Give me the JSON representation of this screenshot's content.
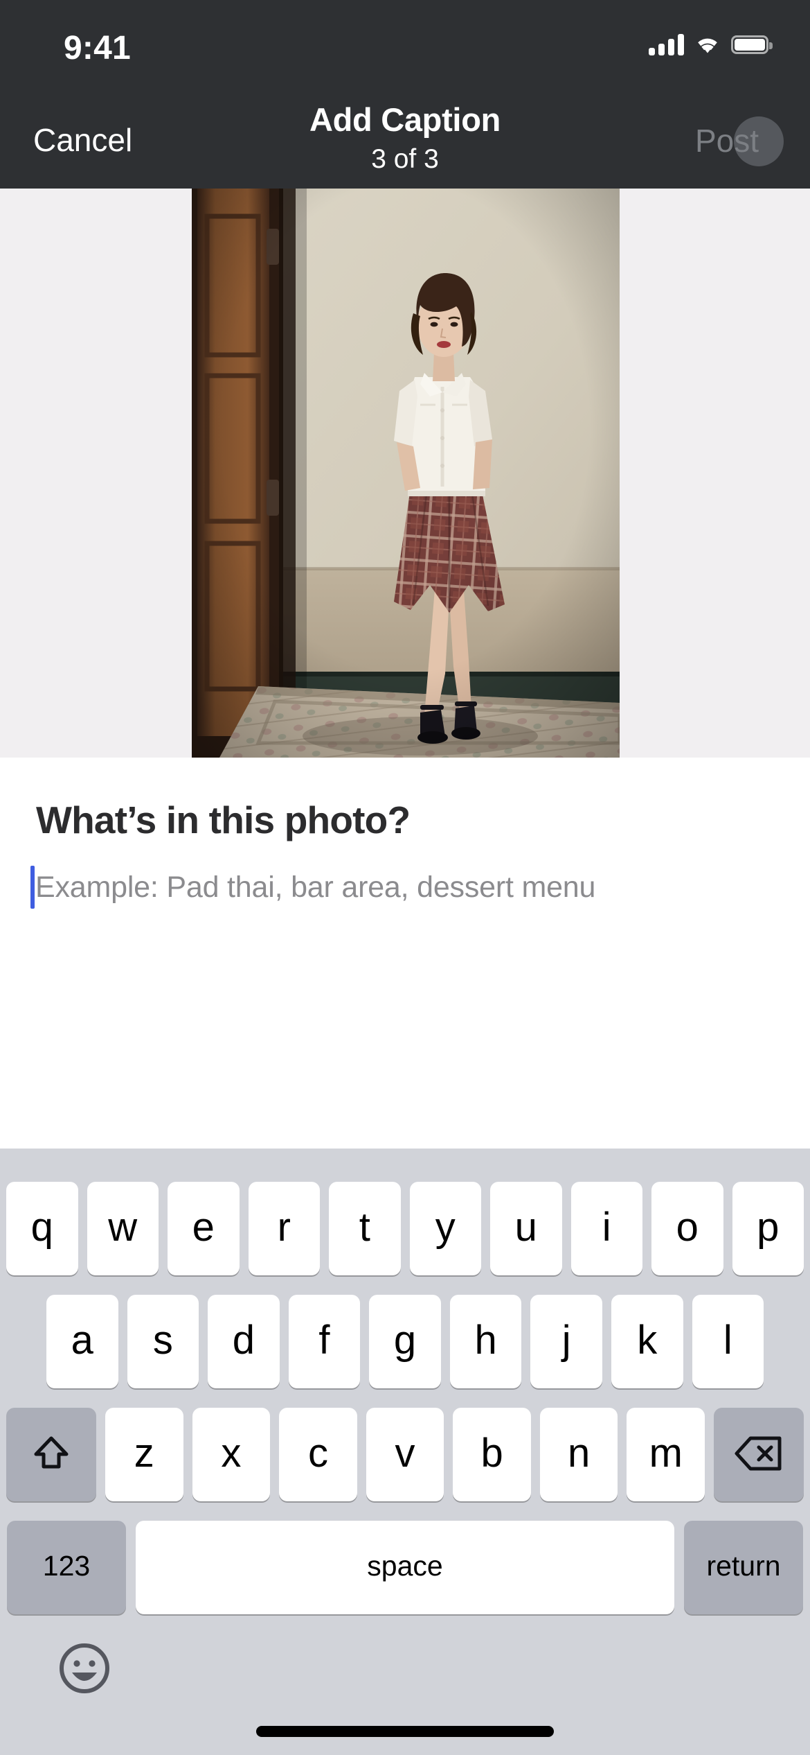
{
  "status_bar": {
    "time": "9:41",
    "cellular_icon": "cellular-signal-icon",
    "wifi_icon": "wifi-icon",
    "battery_icon": "battery-icon"
  },
  "nav_bar": {
    "cancel_label": "Cancel",
    "title": "Add Caption",
    "subtitle": "3 of 3",
    "post_label": "Post",
    "post_enabled": false,
    "background_color": "#2e3033"
  },
  "photo": {
    "alt": "Woman in white blouse and plaid skirt standing in a doorway on a patterned rug",
    "backdrop_color": "#f1eff1"
  },
  "composer": {
    "heading": "What’s in this photo?",
    "caption_value": "",
    "caption_placeholder": "Example: Pad thai, bar area, dessert menu",
    "caret_color": "#3f5de0"
  },
  "keyboard": {
    "background_color": "#d1d3d9",
    "row1": [
      "q",
      "w",
      "e",
      "r",
      "t",
      "y",
      "u",
      "i",
      "o",
      "p"
    ],
    "row2": [
      "a",
      "s",
      "d",
      "f",
      "g",
      "h",
      "j",
      "k",
      "l"
    ],
    "row3": [
      "z",
      "x",
      "c",
      "v",
      "b",
      "n",
      "m"
    ],
    "shift_icon": "shift-arrow-icon",
    "delete_icon": "backspace-delete-icon",
    "numbers_label": "123",
    "space_label": "space",
    "return_label": "return",
    "emoji_icon": "emoji-smiley-icon"
  },
  "home_indicator": {
    "label": "home-indicator"
  }
}
